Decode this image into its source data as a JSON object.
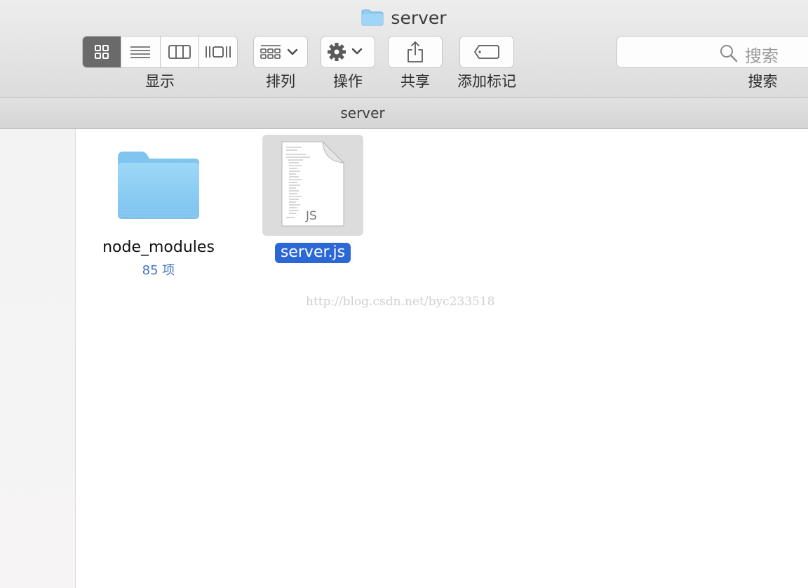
{
  "window": {
    "title": "server"
  },
  "toolbar": {
    "view_label": "显示",
    "sort_label": "排列",
    "action_label": "操作",
    "share_label": "共享",
    "tags_label": "添加标记",
    "search_label": "搜索",
    "search_placeholder": "搜索"
  },
  "pathbar": {
    "path": "server"
  },
  "files": [
    {
      "name": "node_modules",
      "subtitle": "85 项",
      "kind": "folder"
    },
    {
      "name": "server.js",
      "badge": "JS",
      "kind": "js-file",
      "selected": true
    }
  ],
  "watermark": "http://blog.csdn.net/byc233518",
  "colors": {
    "selection": "#2b68d6",
    "folder": "#8fcdf2",
    "subtitle": "#3f73c4"
  }
}
